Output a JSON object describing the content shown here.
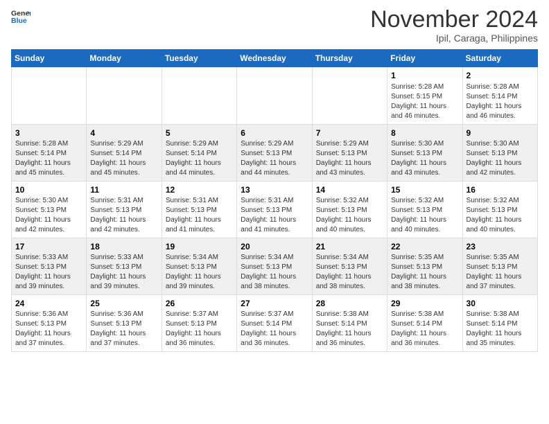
{
  "header": {
    "logo_line1": "General",
    "logo_line2": "Blue",
    "month": "November 2024",
    "location": "Ipil, Caraga, Philippines"
  },
  "weekdays": [
    "Sunday",
    "Monday",
    "Tuesday",
    "Wednesday",
    "Thursday",
    "Friday",
    "Saturday"
  ],
  "weeks": [
    [
      {
        "day": "",
        "info": ""
      },
      {
        "day": "",
        "info": ""
      },
      {
        "day": "",
        "info": ""
      },
      {
        "day": "",
        "info": ""
      },
      {
        "day": "",
        "info": ""
      },
      {
        "day": "1",
        "info": "Sunrise: 5:28 AM\nSunset: 5:15 PM\nDaylight: 11 hours\nand 46 minutes."
      },
      {
        "day": "2",
        "info": "Sunrise: 5:28 AM\nSunset: 5:14 PM\nDaylight: 11 hours\nand 46 minutes."
      }
    ],
    [
      {
        "day": "3",
        "info": "Sunrise: 5:28 AM\nSunset: 5:14 PM\nDaylight: 11 hours\nand 45 minutes."
      },
      {
        "day": "4",
        "info": "Sunrise: 5:29 AM\nSunset: 5:14 PM\nDaylight: 11 hours\nand 45 minutes."
      },
      {
        "day": "5",
        "info": "Sunrise: 5:29 AM\nSunset: 5:14 PM\nDaylight: 11 hours\nand 44 minutes."
      },
      {
        "day": "6",
        "info": "Sunrise: 5:29 AM\nSunset: 5:13 PM\nDaylight: 11 hours\nand 44 minutes."
      },
      {
        "day": "7",
        "info": "Sunrise: 5:29 AM\nSunset: 5:13 PM\nDaylight: 11 hours\nand 43 minutes."
      },
      {
        "day": "8",
        "info": "Sunrise: 5:30 AM\nSunset: 5:13 PM\nDaylight: 11 hours\nand 43 minutes."
      },
      {
        "day": "9",
        "info": "Sunrise: 5:30 AM\nSunset: 5:13 PM\nDaylight: 11 hours\nand 42 minutes."
      }
    ],
    [
      {
        "day": "10",
        "info": "Sunrise: 5:30 AM\nSunset: 5:13 PM\nDaylight: 11 hours\nand 42 minutes."
      },
      {
        "day": "11",
        "info": "Sunrise: 5:31 AM\nSunset: 5:13 PM\nDaylight: 11 hours\nand 42 minutes."
      },
      {
        "day": "12",
        "info": "Sunrise: 5:31 AM\nSunset: 5:13 PM\nDaylight: 11 hours\nand 41 minutes."
      },
      {
        "day": "13",
        "info": "Sunrise: 5:31 AM\nSunset: 5:13 PM\nDaylight: 11 hours\nand 41 minutes."
      },
      {
        "day": "14",
        "info": "Sunrise: 5:32 AM\nSunset: 5:13 PM\nDaylight: 11 hours\nand 40 minutes."
      },
      {
        "day": "15",
        "info": "Sunrise: 5:32 AM\nSunset: 5:13 PM\nDaylight: 11 hours\nand 40 minutes."
      },
      {
        "day": "16",
        "info": "Sunrise: 5:32 AM\nSunset: 5:13 PM\nDaylight: 11 hours\nand 40 minutes."
      }
    ],
    [
      {
        "day": "17",
        "info": "Sunrise: 5:33 AM\nSunset: 5:13 PM\nDaylight: 11 hours\nand 39 minutes."
      },
      {
        "day": "18",
        "info": "Sunrise: 5:33 AM\nSunset: 5:13 PM\nDaylight: 11 hours\nand 39 minutes."
      },
      {
        "day": "19",
        "info": "Sunrise: 5:34 AM\nSunset: 5:13 PM\nDaylight: 11 hours\nand 39 minutes."
      },
      {
        "day": "20",
        "info": "Sunrise: 5:34 AM\nSunset: 5:13 PM\nDaylight: 11 hours\nand 38 minutes."
      },
      {
        "day": "21",
        "info": "Sunrise: 5:34 AM\nSunset: 5:13 PM\nDaylight: 11 hours\nand 38 minutes."
      },
      {
        "day": "22",
        "info": "Sunrise: 5:35 AM\nSunset: 5:13 PM\nDaylight: 11 hours\nand 38 minutes."
      },
      {
        "day": "23",
        "info": "Sunrise: 5:35 AM\nSunset: 5:13 PM\nDaylight: 11 hours\nand 37 minutes."
      }
    ],
    [
      {
        "day": "24",
        "info": "Sunrise: 5:36 AM\nSunset: 5:13 PM\nDaylight: 11 hours\nand 37 minutes."
      },
      {
        "day": "25",
        "info": "Sunrise: 5:36 AM\nSunset: 5:13 PM\nDaylight: 11 hours\nand 37 minutes."
      },
      {
        "day": "26",
        "info": "Sunrise: 5:37 AM\nSunset: 5:13 PM\nDaylight: 11 hours\nand 36 minutes."
      },
      {
        "day": "27",
        "info": "Sunrise: 5:37 AM\nSunset: 5:14 PM\nDaylight: 11 hours\nand 36 minutes."
      },
      {
        "day": "28",
        "info": "Sunrise: 5:38 AM\nSunset: 5:14 PM\nDaylight: 11 hours\nand 36 minutes."
      },
      {
        "day": "29",
        "info": "Sunrise: 5:38 AM\nSunset: 5:14 PM\nDaylight: 11 hours\nand 36 minutes."
      },
      {
        "day": "30",
        "info": "Sunrise: 5:38 AM\nSunset: 5:14 PM\nDaylight: 11 hours\nand 35 minutes."
      }
    ]
  ]
}
